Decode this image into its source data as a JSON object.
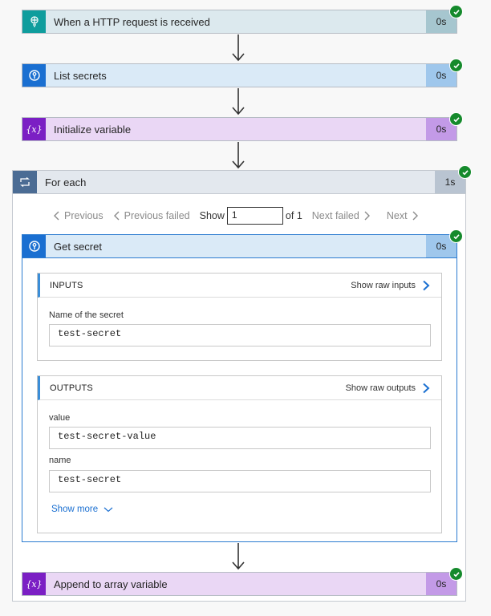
{
  "steps": [
    {
      "title": "When a HTTP request is received",
      "duration": "0s",
      "icon": "http-request-icon",
      "color": "#0f9d9d",
      "bg": "#dce9ee"
    },
    {
      "title": "List secrets",
      "duration": "0s",
      "icon": "key-vault-icon",
      "color": "#1a6fd1",
      "bg": "#daeaf7"
    },
    {
      "title": "Initialize variable",
      "duration": "0s",
      "icon": "variable-icon",
      "color": "#7b1fc4",
      "bg": "#ead7f5"
    }
  ],
  "foreach": {
    "title": "For each",
    "duration": "1s",
    "pager": {
      "previous": "Previous",
      "previous_failed": "Previous failed",
      "show": "Show",
      "page_value": "1",
      "of": "of 1",
      "next_failed": "Next failed",
      "next": "Next"
    },
    "inner": {
      "title": "Get secret",
      "duration": "0s",
      "inputs": {
        "heading": "INPUTS",
        "show_raw": "Show raw inputs",
        "fields": [
          {
            "label": "Name of the secret",
            "value": "test-secret"
          }
        ]
      },
      "outputs": {
        "heading": "OUTPUTS",
        "show_raw": "Show raw outputs",
        "fields": [
          {
            "label": "value",
            "value": "test-secret-value"
          },
          {
            "label": "name",
            "value": "test-secret"
          }
        ],
        "show_more": "Show more"
      }
    }
  },
  "last_step": {
    "title": "Append to array variable",
    "duration": "0s",
    "icon": "variable-icon"
  },
  "colors": {
    "success": "#158a2c",
    "link": "#1a6fd1",
    "accent_bar": "#3b8ed8"
  }
}
